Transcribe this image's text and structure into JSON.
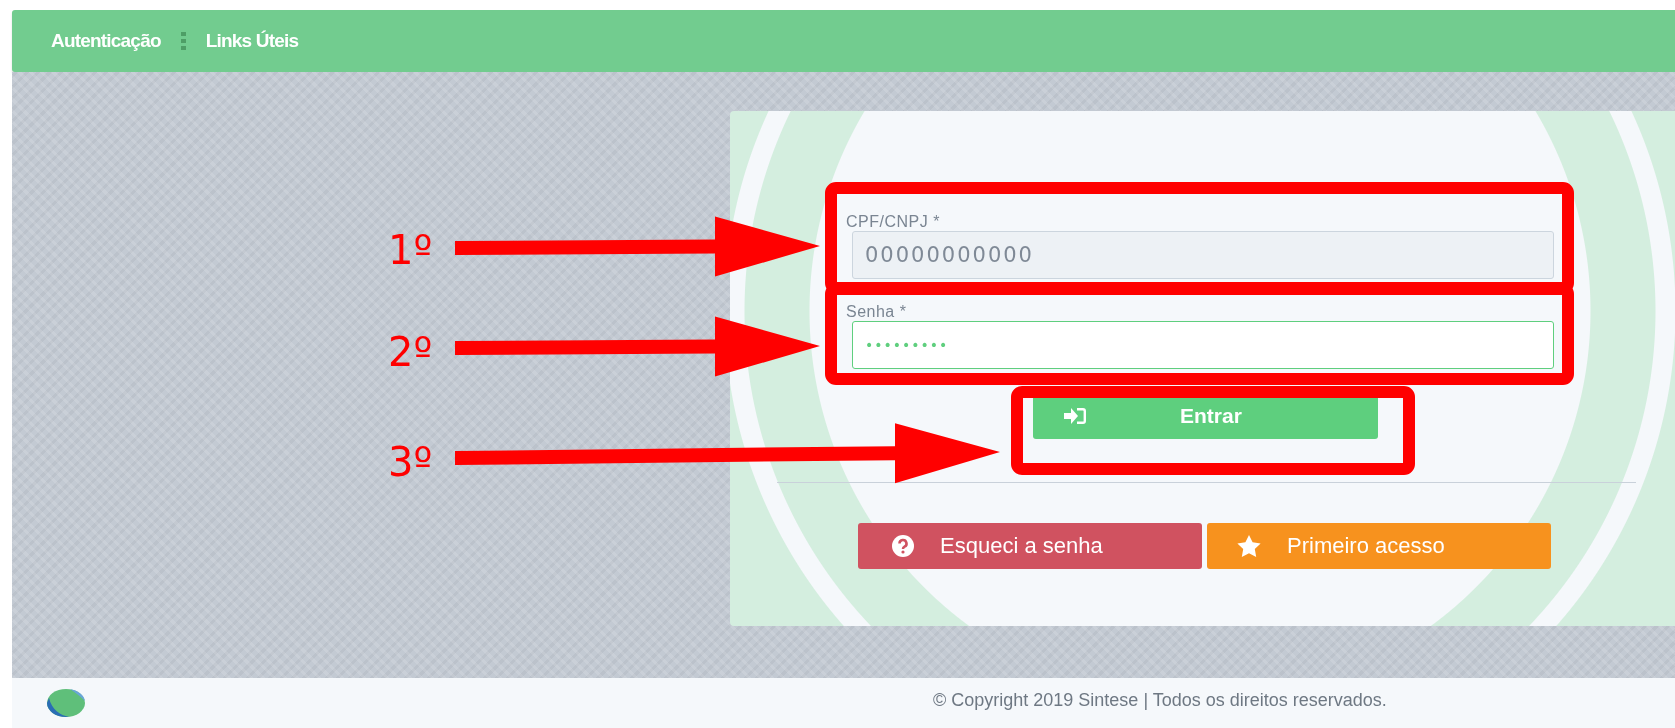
{
  "nav": {
    "items": [
      {
        "label": "Autenticação"
      },
      {
        "label": "Links Úteis"
      }
    ]
  },
  "login": {
    "fields": [
      {
        "label": "CPF/CNPJ *",
        "value": "00000000000",
        "kind": "text"
      },
      {
        "label": "Senha *",
        "value": "•••••••••",
        "kind": "password"
      }
    ],
    "submit": "Entrar",
    "actions": [
      {
        "label": "Esqueci a senha",
        "kind": "forgot"
      },
      {
        "label": "Primeiro acesso",
        "kind": "first"
      }
    ]
  },
  "annotations": [
    {
      "label": "1º"
    },
    {
      "label": "2º"
    },
    {
      "label": "3º"
    }
  ],
  "footer": {
    "text": "© Copyright 2019 Sintese | Todos os direitos reservados."
  }
}
